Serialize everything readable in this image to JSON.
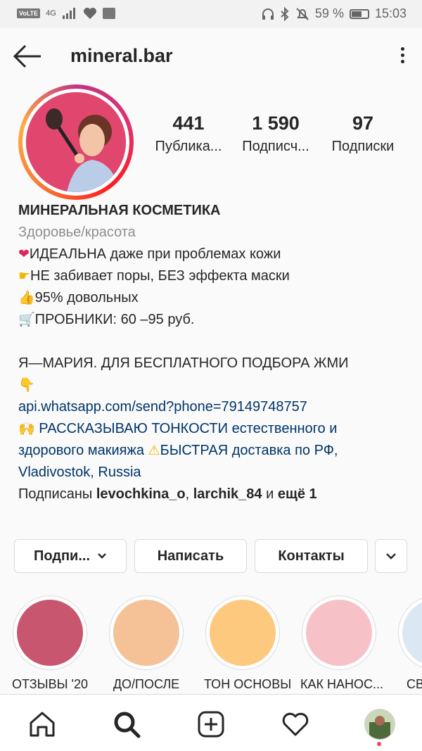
{
  "status_bar": {
    "carrier_badge": "VoLTE",
    "network": "4G",
    "battery": "59 %",
    "time": "15:03"
  },
  "header": {
    "username": "mineral.bar"
  },
  "stats": [
    {
      "value": "441",
      "label": "Публика..."
    },
    {
      "value": "1 590",
      "label": "Подписч..."
    },
    {
      "value": "97",
      "label": "Подписки"
    }
  ],
  "bio": {
    "name": "МИНЕРАЛЬНАЯ КОСМЕТИКА",
    "category": "Здоровье/красота",
    "line1": "ИДЕАЛЬНА даже при проблемах кожи",
    "line2": "НЕ забивает поры, БЕЗ эффекта маски",
    "line3": "95% довольных",
    "line4": "ПРОБНИКИ: 60 –95 руб.",
    "line5": "Я—МАРИЯ. ДЛЯ БЕСПЛАТНОГО ПОДБОРА ЖМИ",
    "link": "api.whatsapp.com/send?phone=79149748757",
    "line7a": " РАССКАЗЫВАЮ ТОНКОСТИ естественного и",
    "line7b": "здорового макияжа ",
    "line7c": "БЫСТРАЯ доставка по РФ,",
    "line8": "Vladivostok, Russia",
    "followed_prefix": "Подписаны ",
    "followed_user1": "levochkina_o",
    "followed_sep": ", ",
    "followed_user2": "larchik_84",
    "followed_and": " и ",
    "followed_more": "ещё 1"
  },
  "buttons": {
    "follow": "Подпи...",
    "message": "Написать",
    "contacts": "Контакты"
  },
  "highlights": [
    {
      "label": "ОТЗЫВЫ '20",
      "color": "#c9566f"
    },
    {
      "label": "ДО/ПОСЛЕ",
      "color": "#f5c196"
    },
    {
      "label": "ТОН ОСНОВЫ",
      "color": "#fdc97e"
    },
    {
      "label": "КАК НАНОС...",
      "color": "#f6c1c7"
    },
    {
      "label": "СВ",
      "color": "#dbe8f3"
    }
  ],
  "colors": {
    "link": "#003569",
    "accent_red": "#ed4956"
  }
}
